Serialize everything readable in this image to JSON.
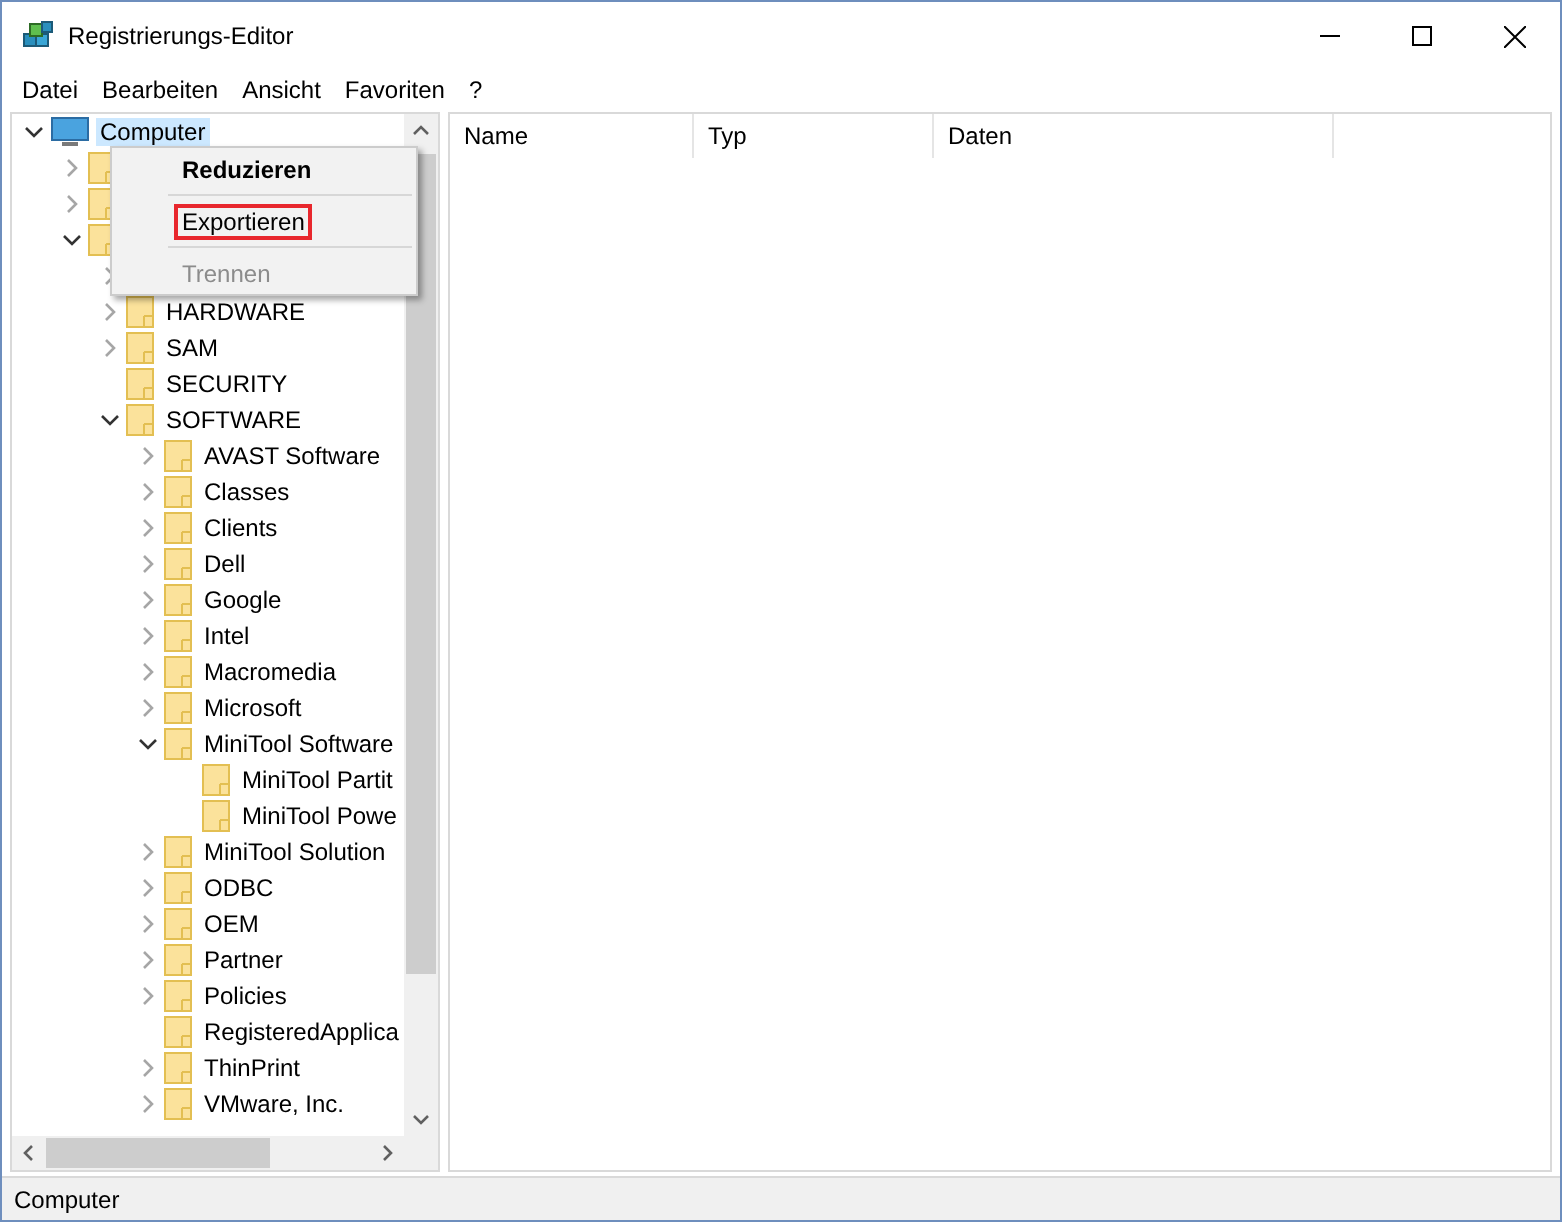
{
  "window": {
    "title": "Registrierungs-Editor"
  },
  "menu_bar": [
    "Datei",
    "Bearbeiten",
    "Ansicht",
    "Favoriten",
    "?"
  ],
  "tree": [
    {
      "label": "Computer",
      "expanded": true,
      "selected": true,
      "children": [
        {
          "expanded": false
        },
        {
          "expanded": false
        },
        {
          "expanded": true,
          "children": [
            {
              "expanded": false
            },
            {
              "label": "HARDWARE",
              "expanded": false,
              "selected": false
            },
            {
              "label": "SAM",
              "expanded": false,
              "selected": false
            },
            {
              "label": "SECURITY",
              "selected": false
            },
            {
              "label": "SOFTWARE",
              "expanded": true,
              "selected": false,
              "children": [
                {
                  "label": "AVAST Software",
                  "expanded": false,
                  "selected": false
                },
                {
                  "label": "Classes",
                  "expanded": false,
                  "selected": false
                },
                {
                  "label": "Clients",
                  "expanded": false,
                  "selected": false
                },
                {
                  "label": "Dell",
                  "expanded": false,
                  "selected": false
                },
                {
                  "label": "Google",
                  "expanded": false,
                  "selected": false
                },
                {
                  "label": "Intel",
                  "expanded": false,
                  "selected": false
                },
                {
                  "label": "Macromedia",
                  "expanded": false,
                  "selected": false
                },
                {
                  "label": "Microsoft",
                  "expanded": false,
                  "selected": false
                },
                {
                  "label": "MiniTool Software",
                  "expanded": true,
                  "selected": false,
                  "children": [
                    {
                      "label": "MiniTool Partit",
                      "selected": false
                    },
                    {
                      "label": "MiniTool Powe",
                      "selected": false
                    }
                  ]
                },
                {
                  "label": "MiniTool Solution",
                  "expanded": false,
                  "selected": false
                },
                {
                  "label": "ODBC",
                  "expanded": false,
                  "selected": false
                },
                {
                  "label": "OEM",
                  "expanded": false,
                  "selected": false
                },
                {
                  "label": "Partner",
                  "expanded": false,
                  "selected": false
                },
                {
                  "label": "Policies",
                  "expanded": false,
                  "selected": false
                },
                {
                  "label": "RegisteredApplica",
                  "selected": false
                },
                {
                  "label": "ThinPrint",
                  "expanded": false,
                  "selected": false
                },
                {
                  "label": "VMware, Inc.",
                  "expanded": false,
                  "selected": false
                }
              ]
            }
          ]
        }
      ]
    }
  ],
  "columns": [
    "Name",
    "Typ",
    "Daten"
  ],
  "context_menu": [
    {
      "kind": "item",
      "label": "Reduzieren",
      "bold": true,
      "disabled": false,
      "highlighted": false
    },
    {
      "kind": "separator"
    },
    {
      "kind": "item",
      "label": "Exportieren",
      "bold": false,
      "disabled": false,
      "highlighted": true
    },
    {
      "kind": "separator"
    },
    {
      "kind": "item",
      "label": "Trennen",
      "bold": false,
      "disabled": true,
      "highlighted": false
    }
  ],
  "status_bar": "Computer"
}
